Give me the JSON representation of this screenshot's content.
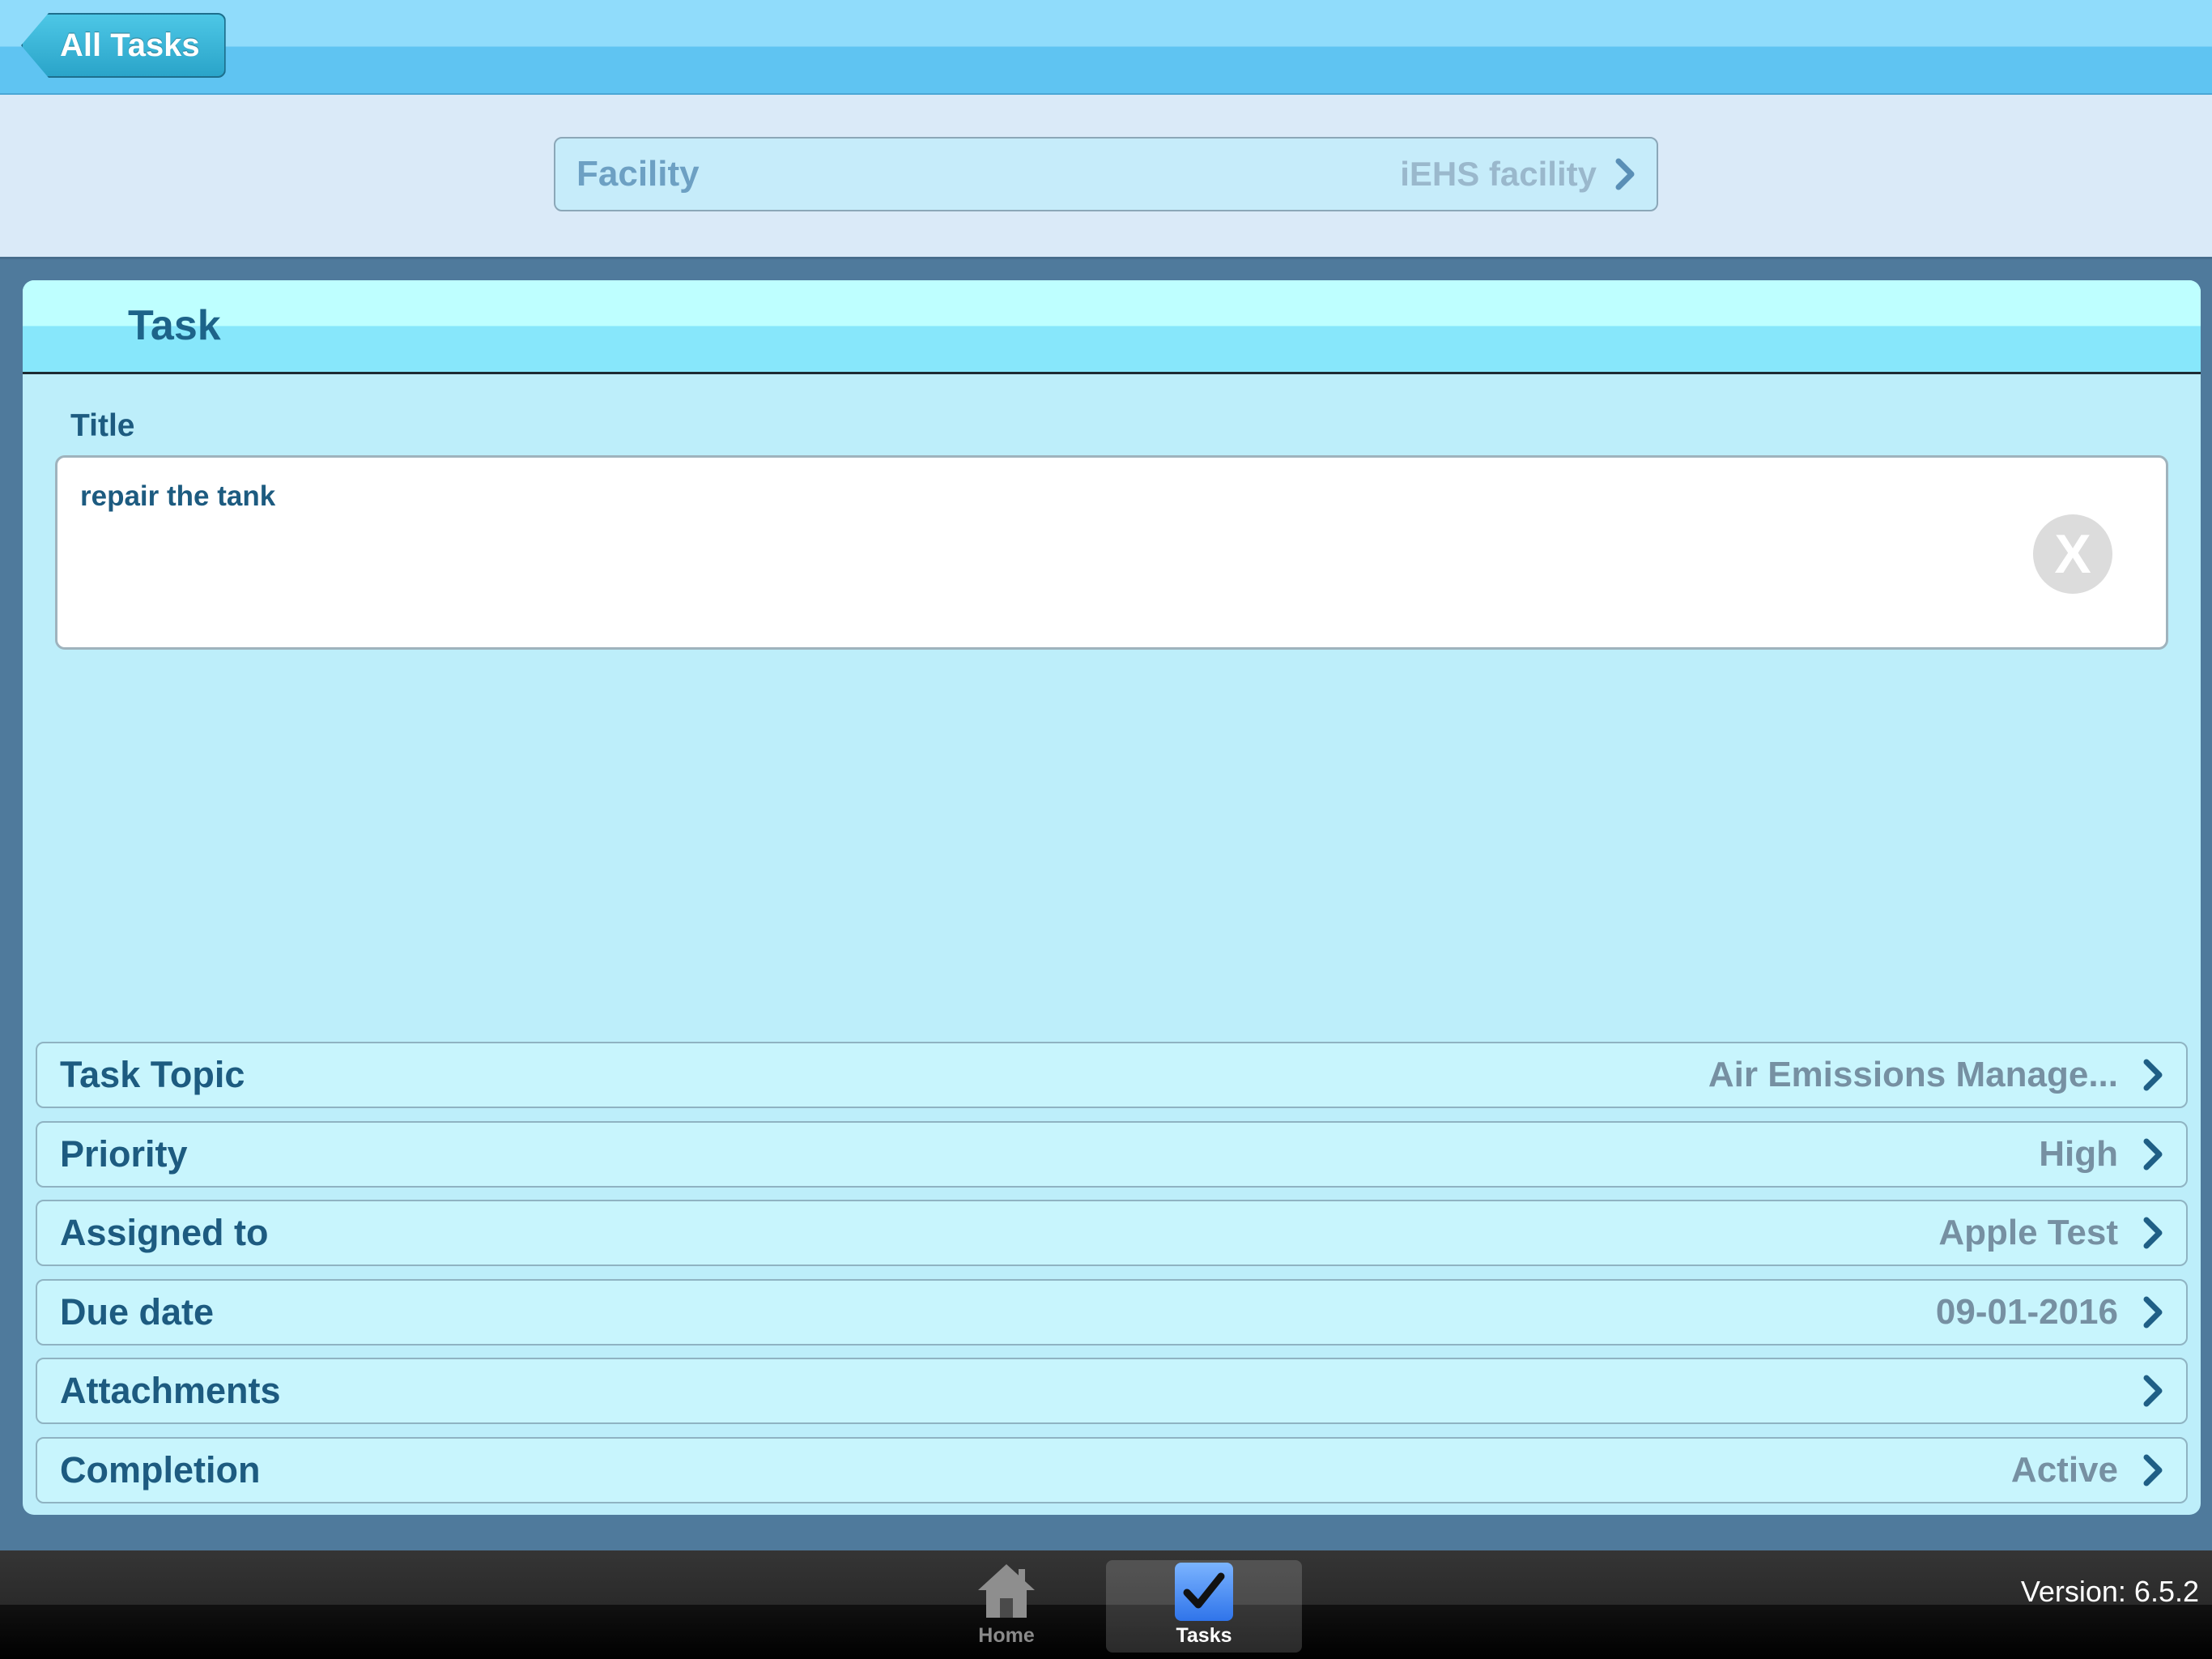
{
  "navbar": {
    "back_label": "All Tasks"
  },
  "facility": {
    "label": "Facility",
    "value": "iEHS facility"
  },
  "task": {
    "header": "Task",
    "title_label": "Title",
    "title_value": "repair the tank",
    "clear_icon": "X"
  },
  "fields": [
    {
      "label": "Task Topic",
      "value": "Air Emissions Manage..."
    },
    {
      "label": "Priority",
      "value": "High"
    },
    {
      "label": "Assigned to",
      "value": "Apple Test"
    },
    {
      "label": "Due date",
      "value": "09-01-2016"
    },
    {
      "label": "Attachments",
      "value": ""
    },
    {
      "label": "Completion",
      "value": "Active"
    }
  ],
  "tabbar": {
    "tabs": [
      {
        "label": "Home",
        "icon": "home-icon",
        "selected": false
      },
      {
        "label": "Tasks",
        "icon": "checkmark-icon",
        "selected": true
      }
    ],
    "version": "Version: 6.5.2"
  },
  "colors": {
    "accent": "#1d5b80",
    "nav_light": "#90dcfb",
    "nav_dark": "#5fc4f2",
    "panel": "#bdeefa",
    "value_text": "#7690a2",
    "tab_selected": "#2f74ea"
  }
}
